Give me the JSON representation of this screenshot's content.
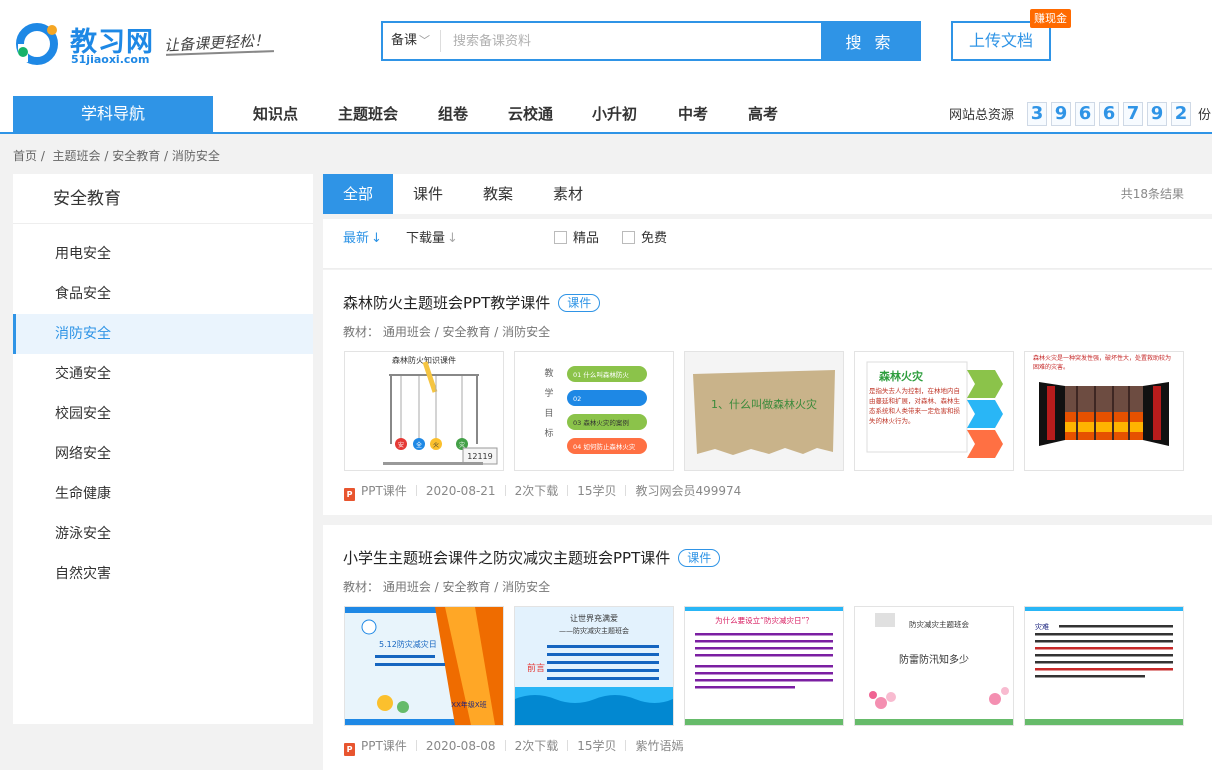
{
  "header": {
    "logo_name": "教习网",
    "logo_domain": "51jiaoxi.com",
    "slogan": "让备课更轻松！",
    "search": {
      "category": "备课",
      "placeholder": "搜索备课资料",
      "button_label": "搜 索"
    },
    "upload_label": "上传文档",
    "earn_badge": "赚现金"
  },
  "nav": {
    "primary": "学科导航",
    "items": [
      "知识点",
      "主题班会",
      "组卷",
      "云校通",
      "小升初",
      "中考",
      "高考"
    ],
    "stats_label": "网站总资源",
    "stats_digits": [
      "3",
      "9",
      "6",
      "6",
      "7",
      "9",
      "2"
    ],
    "stats_unit": "份"
  },
  "breadcrumb": [
    "首页",
    "主题班会",
    "安全教育",
    "消防安全"
  ],
  "sidebar": {
    "title": "安全教育",
    "items": [
      "用电安全",
      "食品安全",
      "消防安全",
      "交通安全",
      "校园安全",
      "网络安全",
      "生命健康",
      "游泳安全",
      "自然灾害"
    ],
    "active": "消防安全"
  },
  "tabs": {
    "items": [
      "全部",
      "课件",
      "教案",
      "素材"
    ],
    "active": "全部",
    "result_count": "共18条结果"
  },
  "filters": {
    "sort_latest": "最新",
    "sort_downloads": "下载量",
    "check_premium": "精品",
    "check_free": "免费"
  },
  "results": [
    {
      "title": "森林防火主题班会PPT教学课件",
      "tag": "课件",
      "meta": "教材： 通用班会  / 安全教育  / 消防安全",
      "type": "PPT课件",
      "date": "2020-08-21",
      "downloads": "2次下载",
      "price": "15学贝",
      "author": "教习网会员499974",
      "thumbs": {
        "t1_title": "森林防火知识课件",
        "t1_balls": [
          "安",
          "全",
          "火",
          "灾"
        ],
        "t1_sign": "12119",
        "t2_side": "教学目标",
        "t2_rows": [
          "01 什么叫森林防火",
          "02",
          "03 森林火灾的案例",
          "04 如何防止森林火灾"
        ],
        "t3_text": "1、什么叫做森林火灾",
        "t4_title": "森林火灾",
        "t4_body": "是指失去人为控制，在林地内自由蔓延和扩展，对森林、森林生态系统和人类带来一定危害和损失的林火行为。",
        "t5_text": "森林火灾是一种突发性强，破坏性大，处置救助较为困难的灾害。"
      }
    },
    {
      "title": "小学生主题班会课件之防灾减灾主题班会PPT课件",
      "tag": "课件",
      "meta": "教材： 通用班会  / 安全教育  / 消防安全",
      "type": "PPT课件",
      "date": "2020-08-08",
      "downloads": "2次下载",
      "price": "15学贝",
      "author": "紫竹语嫣",
      "thumbs": {
        "t1_title": "5.12防灾减灾日",
        "t1_sub": "XX年级X班",
        "t2_title": "让世界充满爱",
        "t2_sub": "——防灾减灾主题班会",
        "t2_side": "前言",
        "t3_title": "为什么要设立“防灾减灾日”？",
        "t4_title": "防灾减灾主题班会",
        "t4_main": "防雷防汛知多少",
        "t5_text": "灾难"
      }
    }
  ],
  "colors": {
    "accent": "#2f94e6",
    "badge": "#ff6a00",
    "ppt": "#e8552f"
  }
}
